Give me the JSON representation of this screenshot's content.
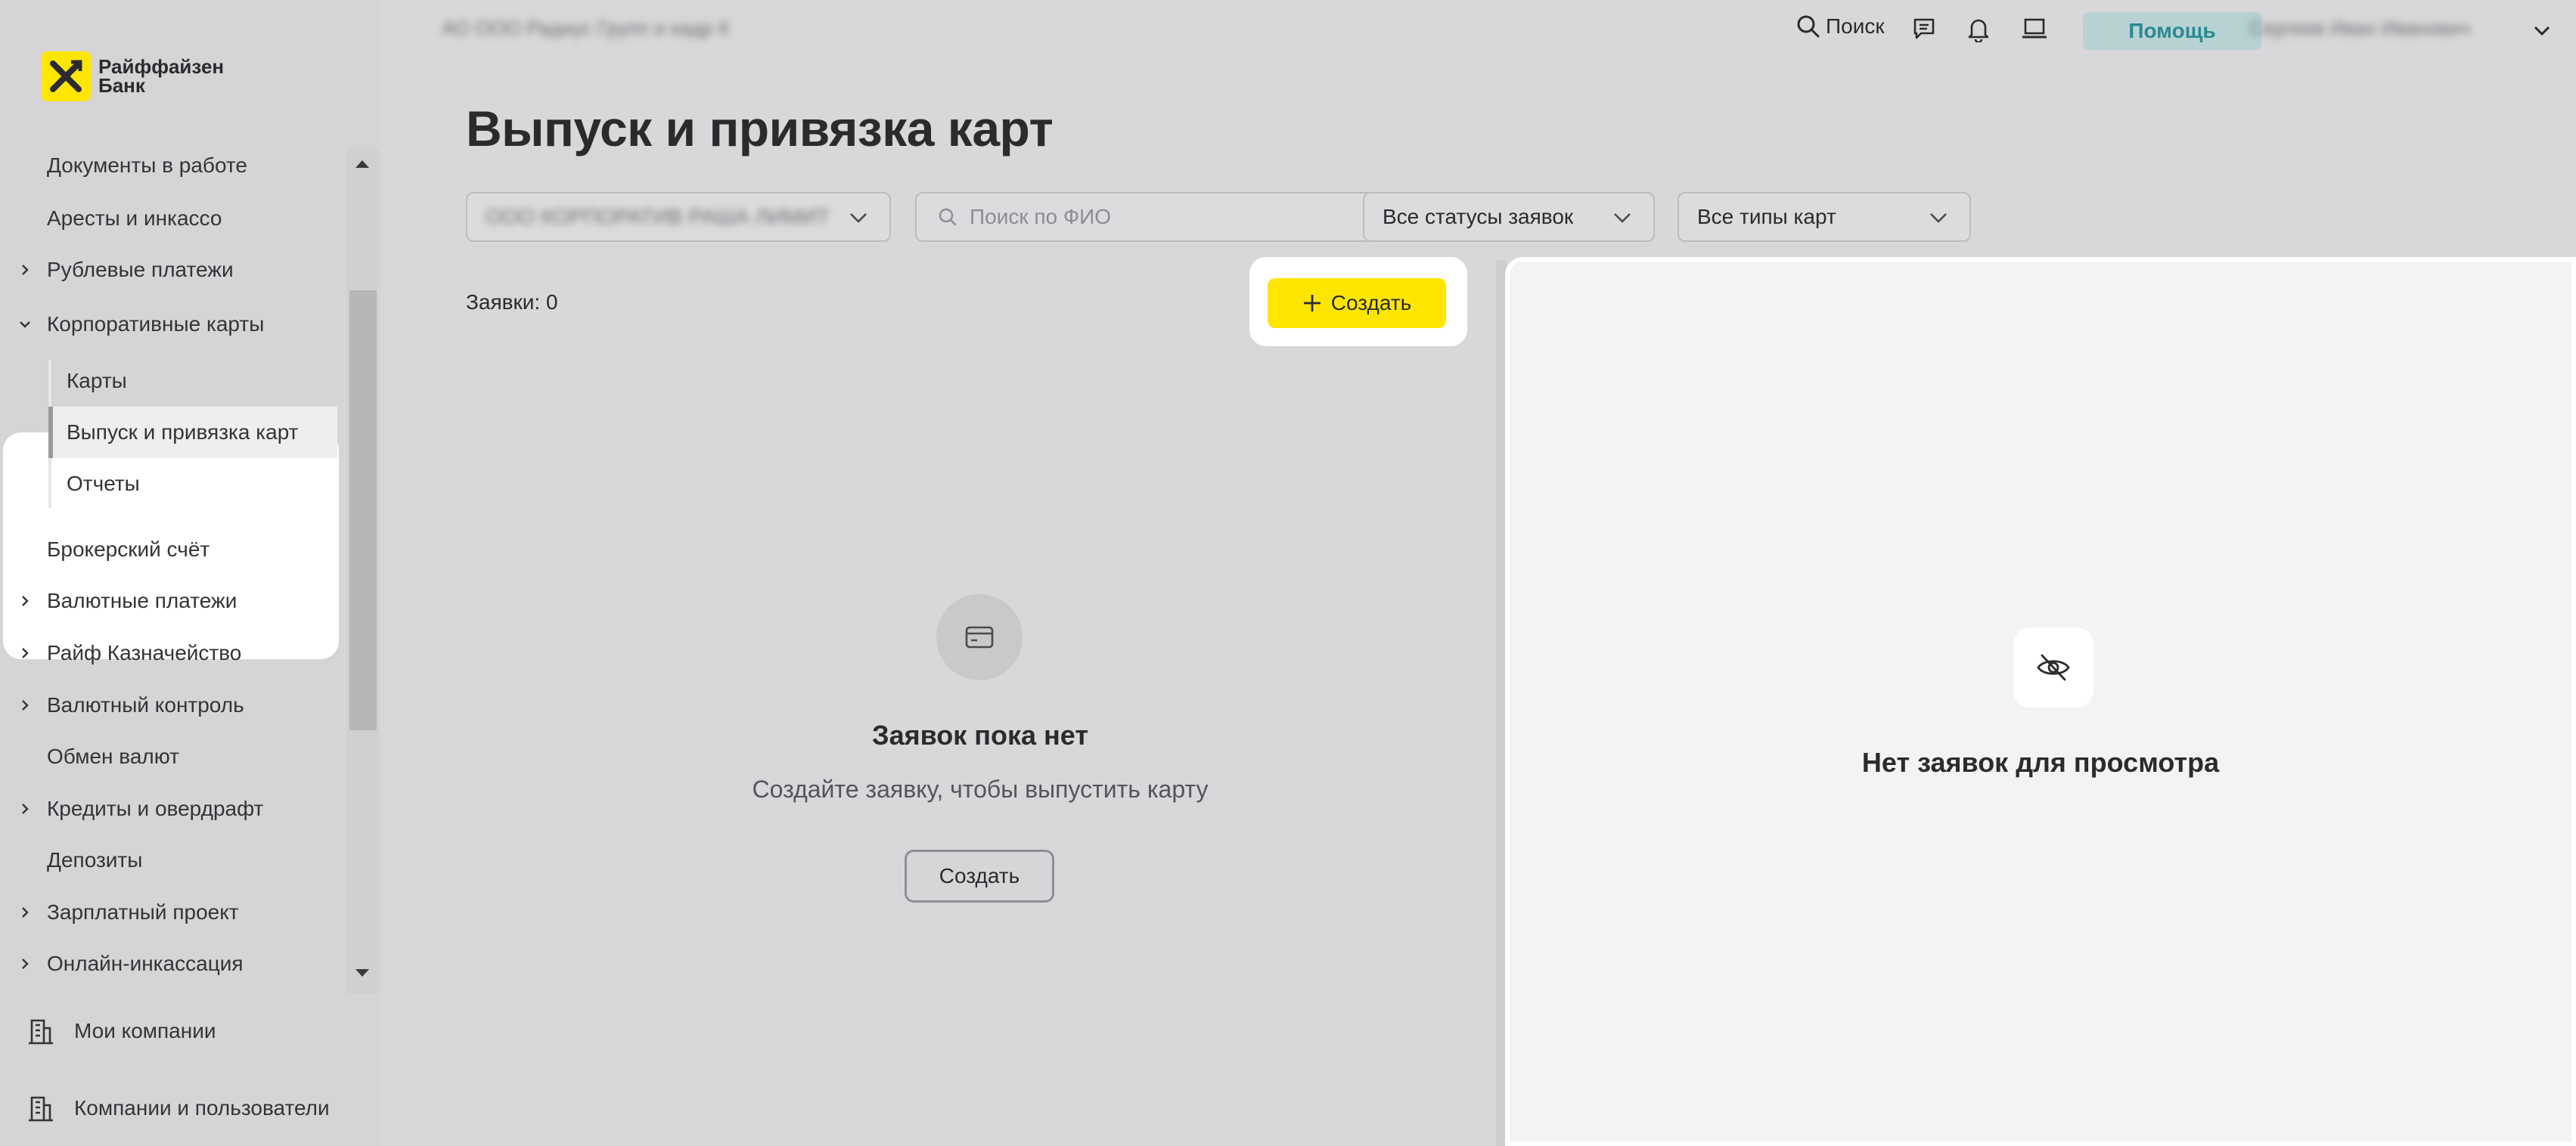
{
  "brand": {
    "name_line1": "Райффайзен",
    "name_line2": "Банк",
    "color": "#fee600"
  },
  "header": {
    "breadcrumb": "АО ООО Радиус Групп и кадр К",
    "search_label": "Поиск",
    "icons": [
      "search-icon",
      "chat-icon",
      "bell-icon",
      "laptop-icon"
    ],
    "help_label": "Помощь",
    "user_name": "Сергеев Иван Иванович"
  },
  "sidebar": {
    "items": [
      {
        "label": "Документы в работе",
        "expandable": false
      },
      {
        "label": "Аресты и инкассо",
        "expandable": false
      },
      {
        "label": "Рублевые платежи",
        "expandable": true
      },
      {
        "label": "Корпоративные карты",
        "expandable": true,
        "expanded": true
      },
      {
        "label": "Брокерский счёт",
        "expandable": false
      },
      {
        "label": "Валютные платежи",
        "expandable": true
      },
      {
        "label": "Райф Казначейство",
        "expandable": true
      },
      {
        "label": "Валютный контроль",
        "expandable": true
      },
      {
        "label": "Обмен валют",
        "expandable": false
      },
      {
        "label": "Кредиты и овердрафт",
        "expandable": true
      },
      {
        "label": "Депозиты",
        "expandable": false
      },
      {
        "label": "Зарплатный проект",
        "expandable": true
      },
      {
        "label": "Онлайн-инкассация",
        "expandable": true
      }
    ],
    "subitems": [
      {
        "label": "Карты",
        "active": false
      },
      {
        "label": "Выпуск и привязка карт",
        "active": true
      },
      {
        "label": "Отчеты",
        "active": false
      }
    ],
    "bottom": [
      {
        "label": "Мои компании",
        "icon": "building-icon"
      },
      {
        "label": "Компании и пользователи",
        "icon": "building-icon"
      }
    ]
  },
  "main": {
    "title": "Выпуск и привязка карт",
    "filters": {
      "company": "ООО КОРПОРАТИВ РАША ЛИМИТ",
      "search_placeholder": "Поиск по ФИО",
      "status": "Все статусы заявок",
      "card_type": "Все типы карт"
    },
    "request_count": "Заявки: 0",
    "create_label": "Создать",
    "empty": {
      "title": "Заявок пока нет",
      "subtitle": "Создайте заявку, чтобы выпустить карту",
      "button": "Создать"
    }
  },
  "preview": {
    "empty_text": "Нет заявок для просмотра"
  }
}
